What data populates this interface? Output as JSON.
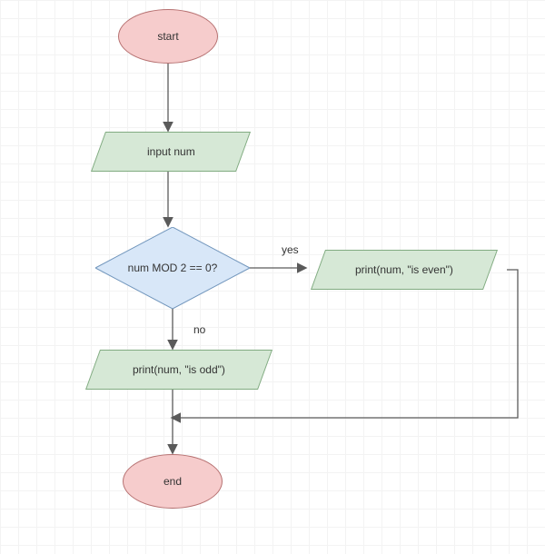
{
  "nodes": {
    "start": "start",
    "input": "input num",
    "decision": "num MOD 2 == 0?",
    "even": "print(num, \"is even\")",
    "odd": "print(num, \"is odd\")",
    "end": "end"
  },
  "edges": {
    "yes": "yes",
    "no": "no"
  },
  "colors": {
    "terminal_fill": "#f6cccc",
    "terminal_stroke": "#b77272",
    "io_fill": "#d6e8d6",
    "io_stroke": "#81ab81",
    "decision_fill": "#d8e7f8",
    "decision_stroke": "#7397bd",
    "line": "#5a5a5a"
  }
}
